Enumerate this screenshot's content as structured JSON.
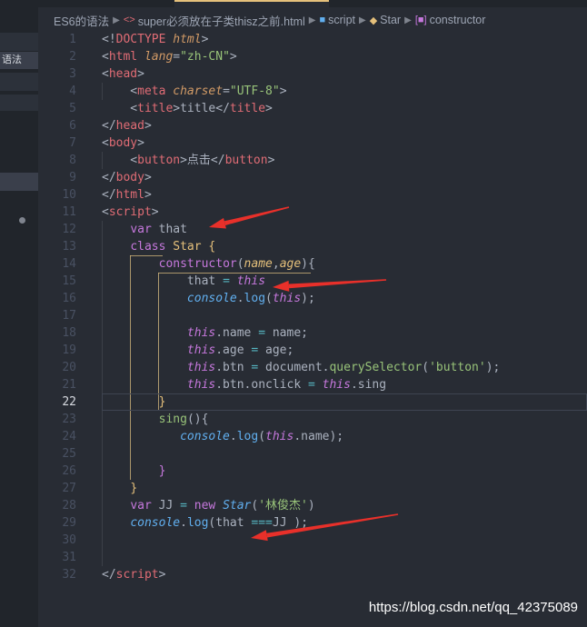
{
  "sidebar": {
    "selected_label": "语法"
  },
  "breadcrumb": {
    "items": [
      {
        "icon": "folder",
        "label": "ES6的语法"
      },
      {
        "icon": "html",
        "label": "super必须放在子类thisz之前.html"
      },
      {
        "icon": "script",
        "label": "script"
      },
      {
        "icon": "class",
        "label": "Star"
      },
      {
        "icon": "method",
        "label": "constructor"
      }
    ]
  },
  "editor": {
    "current_line": 22,
    "lines": [
      {
        "n": "1",
        "tokens": [
          [
            "tk-pl",
            "<!"
          ],
          [
            "tk-tag",
            "DOCTYPE"
          ],
          [
            "tk-pl",
            " "
          ],
          [
            "tk-attr",
            "html"
          ],
          [
            "tk-pl",
            ">"
          ]
        ]
      },
      {
        "n": "2",
        "tokens": [
          [
            "tk-pl",
            "<"
          ],
          [
            "tk-tag",
            "html"
          ],
          [
            "tk-pl",
            " "
          ],
          [
            "tk-attr",
            "lang"
          ],
          [
            "tk-pl",
            "="
          ],
          [
            "tk-str",
            "\"zh-CN\""
          ],
          [
            "tk-pl",
            ">"
          ]
        ]
      },
      {
        "n": "3",
        "tokens": [
          [
            "tk-pl",
            "<"
          ],
          [
            "tk-tag",
            "head"
          ],
          [
            "tk-pl",
            ">"
          ]
        ]
      },
      {
        "n": "4",
        "tokens": [
          [
            "tk-pl",
            "    <"
          ],
          [
            "tk-tag",
            "meta"
          ],
          [
            "tk-pl",
            " "
          ],
          [
            "tk-attr",
            "charset"
          ],
          [
            "tk-pl",
            "="
          ],
          [
            "tk-str",
            "\"UTF-8\""
          ],
          [
            "tk-pl",
            ">"
          ]
        ]
      },
      {
        "n": "5",
        "tokens": [
          [
            "tk-pl",
            "    <"
          ],
          [
            "tk-tag",
            "title"
          ],
          [
            "tk-pl",
            ">title</"
          ],
          [
            "tk-tag",
            "title"
          ],
          [
            "tk-pl",
            ">"
          ]
        ]
      },
      {
        "n": "6",
        "tokens": [
          [
            "tk-pl",
            "</"
          ],
          [
            "tk-tag",
            "head"
          ],
          [
            "tk-pl",
            ">"
          ]
        ]
      },
      {
        "n": "7",
        "tokens": [
          [
            "tk-pl",
            "<"
          ],
          [
            "tk-tag",
            "body"
          ],
          [
            "tk-pl",
            ">"
          ]
        ]
      },
      {
        "n": "8",
        "tokens": [
          [
            "tk-pl",
            "    <"
          ],
          [
            "tk-tag",
            "button"
          ],
          [
            "tk-pl",
            ">点击</"
          ],
          [
            "tk-tag",
            "button"
          ],
          [
            "tk-pl",
            ">"
          ]
        ]
      },
      {
        "n": "9",
        "tokens": [
          [
            "tk-pl",
            "</"
          ],
          [
            "tk-tag",
            "body"
          ],
          [
            "tk-pl",
            ">"
          ]
        ]
      },
      {
        "n": "10",
        "tokens": [
          [
            "tk-pl",
            "</"
          ],
          [
            "tk-tag",
            "html"
          ],
          [
            "tk-pl",
            ">"
          ]
        ]
      },
      {
        "n": "11",
        "tokens": [
          [
            "tk-pl",
            "<"
          ],
          [
            "tk-tag",
            "script"
          ],
          [
            "tk-pl",
            ">"
          ]
        ]
      },
      {
        "n": "12",
        "tokens": [
          [
            "tk-pl",
            "    "
          ],
          [
            "tk-kw",
            "var"
          ],
          [
            "tk-pl",
            " that"
          ]
        ]
      },
      {
        "n": "13",
        "tokens": [
          [
            "tk-pl",
            "    "
          ],
          [
            "tk-kw",
            "class"
          ],
          [
            "tk-pl",
            " "
          ],
          [
            "tk-cls",
            "Star"
          ],
          [
            "tk-pl",
            " "
          ],
          [
            "tk-cls",
            "{"
          ]
        ]
      },
      {
        "n": "14",
        "tokens": [
          [
            "tk-pl",
            "        "
          ],
          [
            "tk-kw",
            "constructor"
          ],
          [
            "tk-pl",
            "("
          ],
          [
            "tk-param",
            "name"
          ],
          [
            "tk-pl",
            ","
          ],
          [
            "tk-param",
            "age"
          ],
          [
            "tk-pl",
            "){"
          ]
        ]
      },
      {
        "n": "15",
        "tokens": [
          [
            "tk-pl",
            "            that "
          ],
          [
            "tk-op",
            "="
          ],
          [
            "tk-pl",
            " "
          ],
          [
            "tk-this",
            "this"
          ]
        ]
      },
      {
        "n": "16",
        "tokens": [
          [
            "tk-pl",
            "            "
          ],
          [
            "tk-console",
            "console"
          ],
          [
            "tk-pl",
            "."
          ],
          [
            "tk-fn",
            "log"
          ],
          [
            "tk-pl",
            "("
          ],
          [
            "tk-this",
            "this"
          ],
          [
            "tk-pl",
            ");"
          ]
        ]
      },
      {
        "n": "17",
        "tokens": []
      },
      {
        "n": "18",
        "tokens": [
          [
            "tk-pl",
            "            "
          ],
          [
            "tk-this",
            "this"
          ],
          [
            "tk-pl",
            ".name "
          ],
          [
            "tk-op",
            "="
          ],
          [
            "tk-pl",
            " name;"
          ]
        ]
      },
      {
        "n": "19",
        "tokens": [
          [
            "tk-pl",
            "            "
          ],
          [
            "tk-this",
            "this"
          ],
          [
            "tk-pl",
            ".age "
          ],
          [
            "tk-op",
            "="
          ],
          [
            "tk-pl",
            " age;"
          ]
        ]
      },
      {
        "n": "20",
        "tokens": [
          [
            "tk-pl",
            "            "
          ],
          [
            "tk-this",
            "this"
          ],
          [
            "tk-pl",
            ".btn "
          ],
          [
            "tk-op",
            "="
          ],
          [
            "tk-pl",
            " document."
          ],
          [
            "tk-method",
            "querySelector"
          ],
          [
            "tk-pl",
            "("
          ],
          [
            "tk-str",
            "'button'"
          ],
          [
            "tk-pl",
            ");"
          ]
        ]
      },
      {
        "n": "21",
        "tokens": [
          [
            "tk-pl",
            "            "
          ],
          [
            "tk-this",
            "this"
          ],
          [
            "tk-pl",
            ".btn.onclick "
          ],
          [
            "tk-op",
            "="
          ],
          [
            "tk-pl",
            " "
          ],
          [
            "tk-this",
            "this"
          ],
          [
            "tk-pl",
            ".sing"
          ]
        ]
      },
      {
        "n": "22",
        "tokens": [
          [
            "tk-pl",
            "        "
          ],
          [
            "tk-cls",
            "}"
          ]
        ]
      },
      {
        "n": "23",
        "tokens": [
          [
            "tk-pl",
            "        "
          ],
          [
            "tk-method",
            "sing"
          ],
          [
            "tk-pl",
            "(){"
          ]
        ]
      },
      {
        "n": "24",
        "tokens": [
          [
            "tk-pl",
            "           "
          ],
          [
            "tk-console",
            "console"
          ],
          [
            "tk-pl",
            "."
          ],
          [
            "tk-fn",
            "log"
          ],
          [
            "tk-pl",
            "("
          ],
          [
            "tk-this",
            "this"
          ],
          [
            "tk-pl",
            ".name);"
          ]
        ]
      },
      {
        "n": "25",
        "tokens": []
      },
      {
        "n": "26",
        "tokens": [
          [
            "tk-pl",
            "        "
          ],
          [
            "tk-kw",
            "}"
          ]
        ]
      },
      {
        "n": "27",
        "tokens": [
          [
            "tk-pl",
            "    "
          ],
          [
            "tk-cls",
            "}"
          ]
        ]
      },
      {
        "n": "28",
        "tokens": [
          [
            "tk-pl",
            "    "
          ],
          [
            "tk-kw",
            "var"
          ],
          [
            "tk-pl",
            " JJ "
          ],
          [
            "tk-op",
            "="
          ],
          [
            "tk-pl",
            " "
          ],
          [
            "tk-kw",
            "new"
          ],
          [
            "tk-pl",
            " "
          ],
          [
            "tk-ital",
            "Star"
          ],
          [
            "tk-pl",
            "("
          ],
          [
            "tk-str",
            "'林俊杰'"
          ],
          [
            "tk-pl",
            ")"
          ]
        ]
      },
      {
        "n": "29",
        "tokens": [
          [
            "tk-pl",
            "    "
          ],
          [
            "tk-console",
            "console"
          ],
          [
            "tk-pl",
            "."
          ],
          [
            "tk-fn",
            "log"
          ],
          [
            "tk-pl",
            "(that "
          ],
          [
            "tk-op",
            "==="
          ],
          [
            "tk-pl",
            "JJ );"
          ]
        ]
      },
      {
        "n": "30",
        "tokens": []
      },
      {
        "n": "31",
        "tokens": []
      },
      {
        "n": "32",
        "tokens": [
          [
            "tk-pl",
            "</"
          ],
          [
            "tk-tag",
            "script"
          ],
          [
            "tk-pl",
            ">"
          ]
        ]
      }
    ]
  },
  "annotation_color": "#e8302a",
  "watermark": "https://blog.csdn.net/qq_42375089"
}
